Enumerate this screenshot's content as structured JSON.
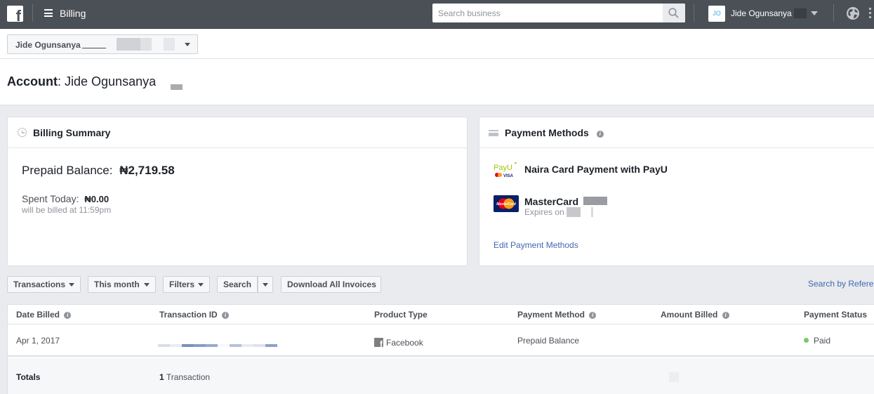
{
  "topbar": {
    "title": "Billing",
    "search_placeholder": "Search business",
    "search_value": "",
    "user_initials": "JO",
    "user_name": "Jide Ogunsanya"
  },
  "account_selector": {
    "label": "Jide Ogunsanya"
  },
  "account_header": {
    "label": "Account",
    "name": "Jide Ogunsanya"
  },
  "billing_summary": {
    "title": "Billing Summary",
    "prepaid_label": "Prepaid Balance:",
    "prepaid_value": "₦2,719.58",
    "spent_label": "Spent Today:",
    "spent_value": "₦0.00",
    "billed_note": "will be billed at 11:59pm"
  },
  "payment_methods": {
    "title": "Payment Methods",
    "info_icon": "i",
    "methods": [
      {
        "name": "Naira Card Payment with PayU",
        "logo": "payu-logo"
      },
      {
        "name": "MasterCard",
        "sub": "Expires on",
        "logo": "mastercard-logo"
      }
    ],
    "edit_link": "Edit Payment Methods",
    "logo_text": {
      "payu": "PayU",
      "visa": "VISA",
      "mastercard": "MasterCard"
    }
  },
  "toolbar": {
    "transactions": "Transactions",
    "period": "This month",
    "filters": "Filters",
    "search": "Search",
    "download": "Download All Invoices",
    "search_by_reference": "Search by Refere"
  },
  "table": {
    "columns": [
      "Date Billed",
      "Transaction ID",
      "Product Type",
      "Payment Method",
      "Amount Billed",
      "Payment Status"
    ],
    "rows": [
      {
        "date": "Apr 1, 2017",
        "transaction_id": "",
        "product_type": "Facebook",
        "payment_method": "Prepaid Balance",
        "amount": "",
        "status": "Paid"
      }
    ],
    "totals_label": "Totals",
    "totals_count": "1",
    "totals_unit": "Transaction"
  },
  "colors": {
    "topbar": "#4b4f56",
    "link": "#4267b2",
    "paid": "#7bc86c",
    "background": "#e9ebee"
  }
}
